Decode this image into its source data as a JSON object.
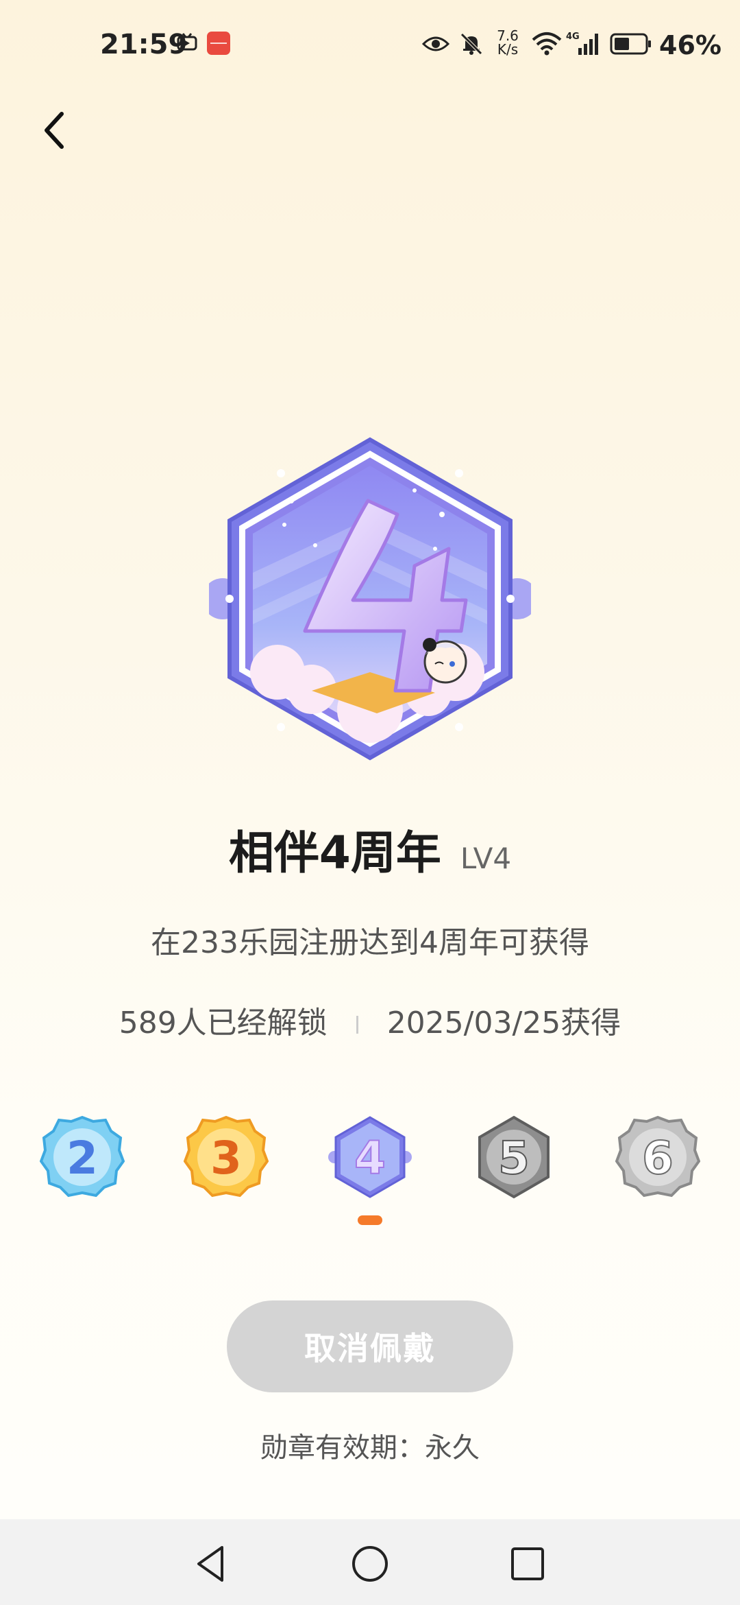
{
  "status_bar": {
    "time": "21:59",
    "net_speed_value": "7.6",
    "net_speed_unit": "K/s",
    "battery": "46%",
    "icons": [
      "tv-icon",
      "huawei-app-icon",
      "eye-icon",
      "bell-muted-icon",
      "wifi-icon",
      "cellular-4g-icon",
      "battery-icon"
    ]
  },
  "header": {
    "back_icon": "chevron-left-icon"
  },
  "badge": {
    "number": "4",
    "title": "相伴4周年",
    "level": "LV4",
    "description": "在233乐园注册达到4周年可获得",
    "unlocked_count": "589人已经解锁",
    "obtained_date": "2025/03/25获得"
  },
  "badge_list": {
    "items": [
      {
        "number": "2",
        "state": "unlocked",
        "color": "#4fb6ea"
      },
      {
        "number": "3",
        "state": "unlocked",
        "color": "#f5a623"
      },
      {
        "number": "4",
        "state": "selected",
        "color": "#8d86f0"
      },
      {
        "number": "5",
        "state": "locked",
        "color": "#9a9a9a"
      },
      {
        "number": "6",
        "state": "locked",
        "color": "#b5b5b5"
      }
    ],
    "indicator_color": "#f57a2a"
  },
  "actions": {
    "cancel_wear_label": "取消佩戴"
  },
  "validity": "勋章有效期：永久",
  "nav_bar": {
    "icons": [
      "back-triangle-icon",
      "home-circle-icon",
      "recents-square-icon"
    ]
  }
}
